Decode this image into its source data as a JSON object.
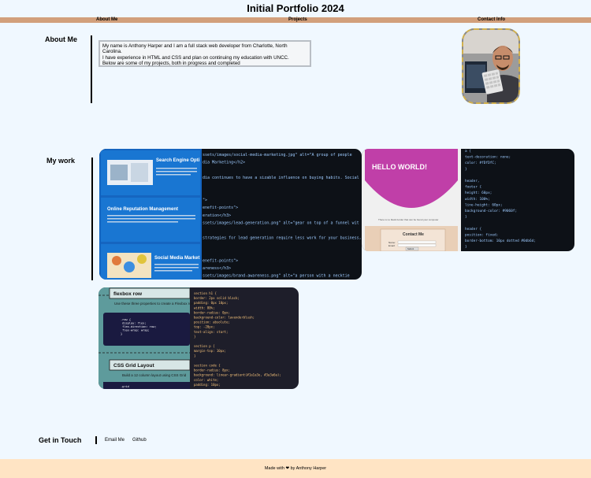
{
  "site_title": "Initial Portfolio 2024",
  "nav": {
    "about": "About Me",
    "projects": "Projects",
    "contact": "Contact Info"
  },
  "about": {
    "heading": "About Me",
    "bio_line1": "My name is Anthony Harper and I am a full stack web developer from Charlotte, North Carolina.",
    "bio_line2": "I have experience in HTML and CSS and plan on continuing my education with UNCC.",
    "bio_line3": "Below are some of my projects, both in progress and completed"
  },
  "work": {
    "heading": "My work",
    "project1": {
      "panel1_title": "Search Engine Opti",
      "panel2_title": "Online Reputation Management",
      "panel3_title": "Social Media Market",
      "code_lines": [
        "ssets/images/social-media-marketing.jpg\" alt=\"A group of people ",
        "dia Marketing</h2>",
        "",
        "dia continues to have a sizable influence on buying habits. Social",
        "",
        "",
        "\">",
        "enefit-points\">",
        "eration</h3>",
        "ssets/images/lead-generation.png\" alt=\"gear on top of a funnel wit",
        "",
        "strategies for lead generation require less work for your business,",
        "",
        "",
        "enefit-points\">",
        "areness</h3>",
        "ssets/images/brand-awareness.png\" alt=\"a person with a necktie "
      ]
    },
    "project2": {
      "hello": "HELLO WORLD!",
      "caption": "There is no black border that can be found your computer",
      "contact_title": "Contact Me",
      "name_label": "Name:",
      "email_label": "Email:",
      "submit": "Submit",
      "code_lines": [
        "a {",
        "  text-decoration: none;",
        "  color: #fDfDfC;",
        "}",
        "",
        "header,",
        "footer {",
        "  height: 60px;",
        "  width: 100%;",
        "  line-height: 60px;",
        "  background-color: #9060f;",
        "}",
        "",
        "header {",
        "  position: fixed;",
        "  border-bottom: 10px dotted #0db6d;",
        "}"
      ]
    },
    "project3": {
      "flex_title": "flexbox row",
      "flex_text": "Use these three properties to create a Flexbox row layout",
      "flex_code": ".row {\n  display: flex;\n  flex-direction: row;\n  flex-wrap: wrap;\n}",
      "grid_title": "CSS Grid Layout",
      "grid_text": "Build a 12 column layout using CSS Grid",
      "grid_code": ".grid",
      "code_lines": [
        "section h1 {",
        "  border: 2px solid black;",
        "  padding: 0px 10px;",
        "  width: 80%;",
        "  border-radius: 0px;",
        "  background-color: lavenderblush;",
        "  position: absolute;",
        "  top: -20px;",
        "  text-align: start;",
        "}",
        "",
        "section p {",
        "  margin-top: 10px;",
        "}",
        "",
        "section code {",
        "  border-radius: 8px;",
        "  background: linear-gradient(#1a1a3e, #3a3a6a);",
        "  color: white;",
        "  padding: 10px;"
      ]
    }
  },
  "contact": {
    "heading": "Get in Touch",
    "email": "Email Me",
    "github": "Github"
  },
  "footer": {
    "text": "Made with ❤ by Anthony Harper"
  },
  "colors": {
    "background": "#f0f8ff",
    "nav": "#d2a07c",
    "footer": "#ffe4c4",
    "avatar_border": "#d1b04e",
    "code_bg": "#0d1117",
    "flex_card_bg": "#5e9b9c"
  }
}
